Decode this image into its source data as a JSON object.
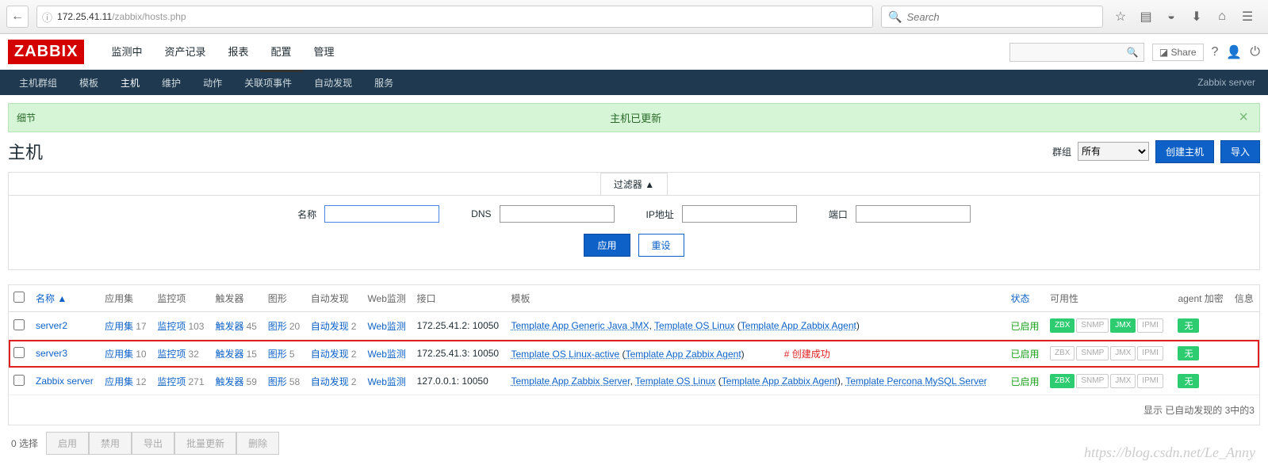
{
  "browser": {
    "url_host": "172.25.41.11",
    "url_path": "/zabbix/hosts.php",
    "search_placeholder": "Search"
  },
  "top": {
    "logo": "ZABBIX",
    "menu": [
      "监测中",
      "资产记录",
      "报表",
      "配置",
      "管理"
    ],
    "active_menu": 3,
    "share": "Share",
    "server": "Zabbix server"
  },
  "subnav": {
    "items": [
      "主机群组",
      "模板",
      "主机",
      "维护",
      "动作",
      "关联项事件",
      "自动发现",
      "服务"
    ],
    "active": 2
  },
  "alert": {
    "toggle": "细节",
    "msg": "主机已更新"
  },
  "page": {
    "title": "主机",
    "group_label": "群组",
    "group_value": "所有",
    "btn_create": "创建主机",
    "btn_import": "导入"
  },
  "filter": {
    "tab": "过滤器 ▲",
    "name": "名称",
    "dns": "DNS",
    "ip": "IP地址",
    "port": "端口",
    "apply": "应用",
    "reset": "重设"
  },
  "table": {
    "cols": [
      "名称 ▲",
      "应用集",
      "监控项",
      "触发器",
      "图形",
      "自动发现",
      "Web监测",
      "接口",
      "模板",
      "状态",
      "可用性",
      "agent 加密",
      "信息"
    ],
    "rows": [
      {
        "name": "server2",
        "apps": "应用集",
        "apps_n": "17",
        "items": "监控项",
        "items_n": "103",
        "trig": "触发器",
        "trig_n": "45",
        "graph": "图形",
        "graph_n": "20",
        "disc": "自动发现",
        "disc_n": "2",
        "web": "Web监测",
        "iface": "172.25.41.2: 10050",
        "tpl": [
          {
            "t": "Template App Generic Java JMX",
            "l": true
          },
          {
            "t": ", "
          },
          {
            "t": "Template OS Linux",
            "l": true
          },
          {
            "t": " ("
          },
          {
            "t": "Template App Zabbix Agent",
            "l": true
          },
          {
            "t": ")"
          }
        ],
        "status": "已启用",
        "avail": [
          "g",
          "",
          "g",
          ""
        ],
        "enc": "无",
        "anno": ""
      },
      {
        "name": "server3",
        "apps": "应用集",
        "apps_n": "10",
        "items": "监控项",
        "items_n": "32",
        "trig": "触发器",
        "trig_n": "15",
        "graph": "图形",
        "graph_n": "5",
        "disc": "自动发现",
        "disc_n": "2",
        "web": "Web监测",
        "iface": "172.25.41.3: 10050",
        "tpl": [
          {
            "t": "Template OS Linux-active",
            "l": true
          },
          {
            "t": " ("
          },
          {
            "t": "Template App Zabbix Agent",
            "l": true
          },
          {
            "t": ")"
          }
        ],
        "status": "已启用",
        "avail": [
          "",
          "",
          "",
          ""
        ],
        "enc": "无",
        "anno": "# 创建成功",
        "hl": true
      },
      {
        "name": "Zabbix server",
        "apps": "应用集",
        "apps_n": "12",
        "items": "监控项",
        "items_n": "271",
        "trig": "触发器",
        "trig_n": "59",
        "graph": "图形",
        "graph_n": "58",
        "disc": "自动发现",
        "disc_n": "2",
        "web": "Web监测",
        "iface": "127.0.0.1: 10050",
        "tpl": [
          {
            "t": "Template App Zabbix Server",
            "l": true
          },
          {
            "t": ", "
          },
          {
            "t": "Template OS Linux",
            "l": true
          },
          {
            "t": " ("
          },
          {
            "t": "Template App Zabbix Agent",
            "l": true
          },
          {
            "t": "), "
          },
          {
            "t": "Template Percona MySQL Server",
            "l": true
          }
        ],
        "status": "已启用",
        "avail": [
          "g",
          "",
          "",
          ""
        ],
        "enc": "无",
        "anno": ""
      }
    ],
    "avail_labels": [
      "ZBX",
      "SNMP",
      "JMX",
      "IPMI"
    ],
    "footer": "显示 已自动发现的 3中的3"
  },
  "bulk": {
    "selected": "0 选择",
    "btns": [
      "启用",
      "禁用",
      "导出",
      "批量更新",
      "删除"
    ]
  },
  "watermark": "https://blog.csdn.net/Le_Anny"
}
